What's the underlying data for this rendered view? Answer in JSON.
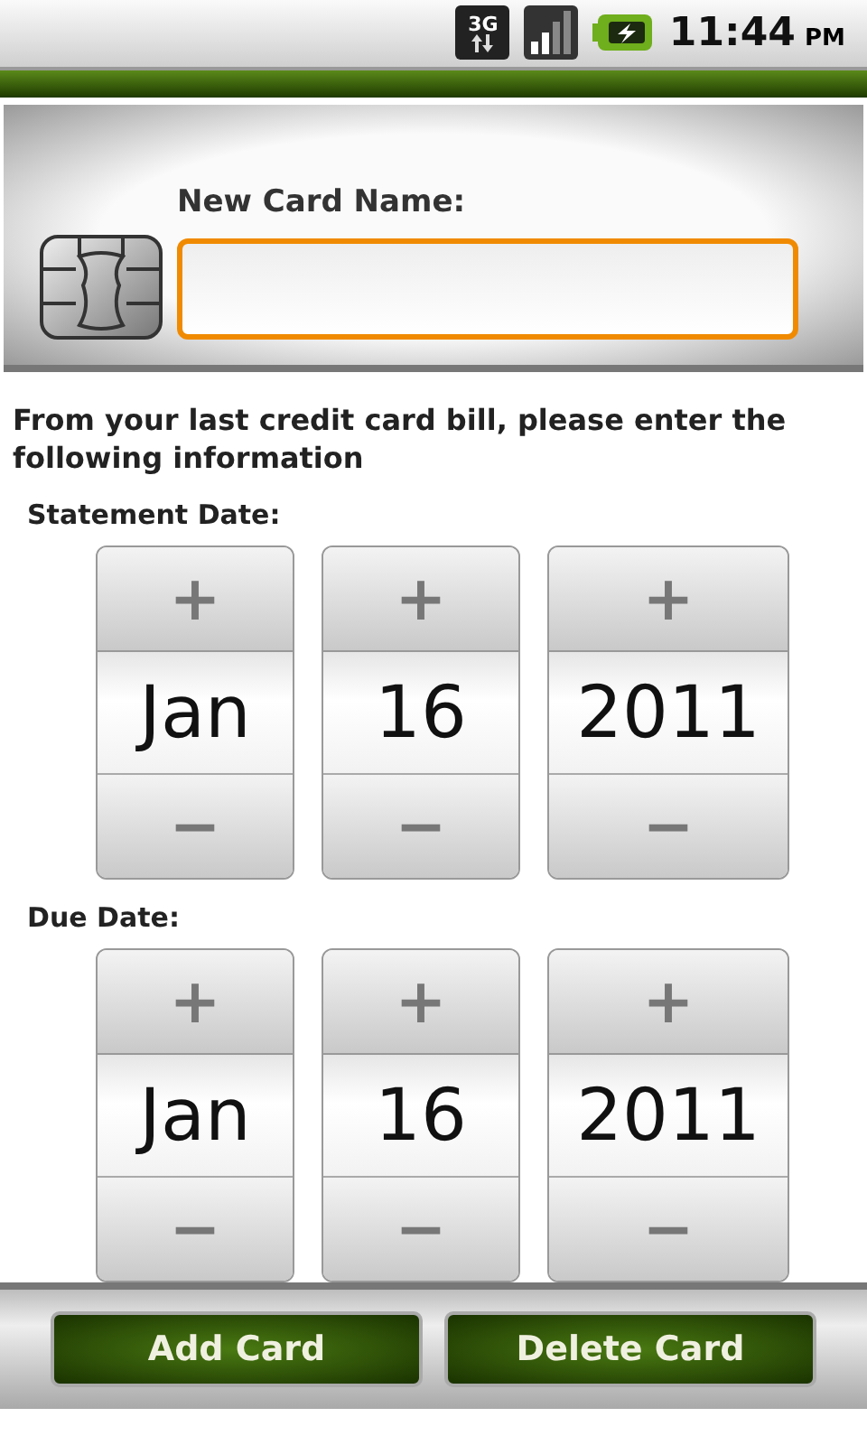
{
  "status_bar": {
    "network": "3G",
    "time": "11:44",
    "ampm": "PM"
  },
  "card_name": {
    "label": "New Card Name:",
    "focused": true
  },
  "instructions": "From your last credit card bill, please enter the following information",
  "date_groups": [
    {
      "label": "Statement Date:",
      "increment": "+",
      "decrement": "−",
      "fields": [
        "Jan",
        "16",
        "2011"
      ]
    },
    {
      "label": "Due Date:",
      "increment": "+",
      "decrement": "−",
      "fields": [
        "Jan",
        "16",
        "2011"
      ]
    }
  ],
  "buttons": [
    "Add Card",
    "Delete Card"
  ]
}
